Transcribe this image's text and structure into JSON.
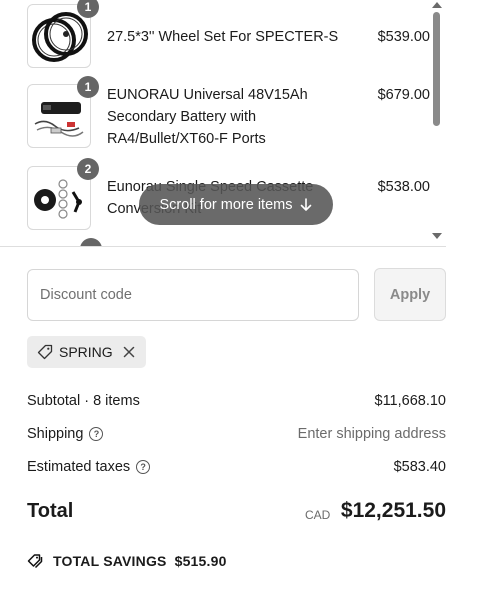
{
  "items": [
    {
      "title": "27.5*3'' Wheel Set For SPECTER-S",
      "price": "$539.00",
      "qty": "1",
      "thumb": "wheel-set-icon"
    },
    {
      "title": "EUNORAU Universal 48V15Ah Secondary Battery with RA4/Bullet/XT60-F Ports",
      "price": "$679.00",
      "qty": "1",
      "thumb": "battery-icon"
    },
    {
      "title": "Eunorau Single Speed Cassette Conversion Kit",
      "price": "$538.00",
      "qty": "2",
      "thumb": "cassette-kit-icon"
    }
  ],
  "scroll_hint": "Scroll for more items",
  "discount": {
    "placeholder": "Discount code",
    "apply_label": "Apply",
    "applied_code": "SPRING"
  },
  "summary": {
    "subtotal_label": "Subtotal · 8 items",
    "subtotal_value": "$11,668.10",
    "shipping_label": "Shipping",
    "shipping_value": "Enter shipping address",
    "taxes_label": "Estimated taxes",
    "taxes_value": "$583.40",
    "total_label": "Total",
    "currency": "CAD",
    "total_value": "$12,251.50",
    "savings_label": "TOTAL SAVINGS",
    "savings_value": "$515.90"
  },
  "colors": {
    "badge": "#666666",
    "pill": "#555555",
    "apply_text": "#8a8a8a"
  }
}
